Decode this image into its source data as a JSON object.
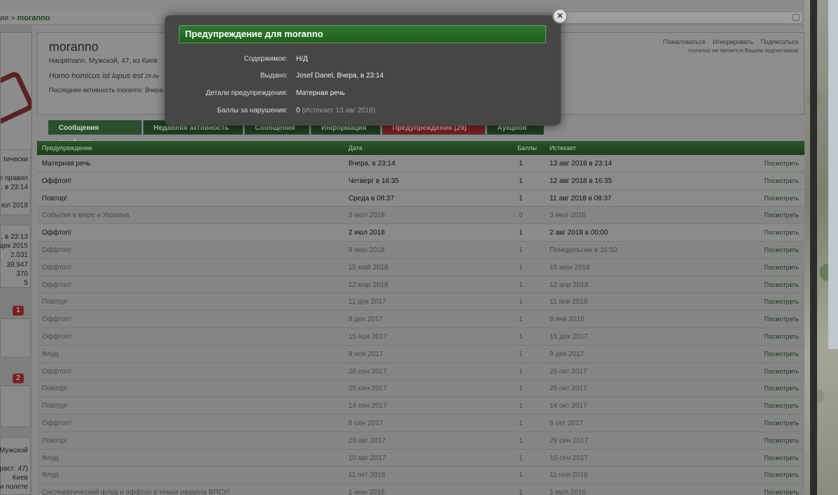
{
  "breadcrumb": {
    "prefix": "ии",
    "separator": "»",
    "current": "moranno"
  },
  "profile": {
    "name": "moranno",
    "info": "Hauptmann, Мужской, 47, из Киев",
    "quote": "Homo homicus ist lupus est",
    "quote_date": "29 де",
    "last_activity": "Последняя активность moranno: Вчера",
    "actions": [
      "Пожаловаться",
      "Игнорировать",
      "Подписаться"
    ],
    "subscription_note": "moranno не является Вашим подписчиком"
  },
  "tabs": [
    {
      "label": "Сообщения профиля"
    },
    {
      "label": "Недавняя активность"
    },
    {
      "label": "Сообщения"
    },
    {
      "label": "Информация"
    },
    {
      "label": "Предупреждения (29)"
    },
    {
      "label": "Аукцион"
    }
  ],
  "sidebar": {
    "texts": [
      "тически",
      "е правил",
      ", в 23:14",
      "юл 2018",
      ", в 23:13",
      "дек 2015",
      "2.031",
      "39.947",
      "370",
      "5",
      "Мужской",
      "раст: 47)",
      "Киев",
      "и полете"
    ],
    "badges": [
      "1",
      "2"
    ]
  },
  "table": {
    "headers": {
      "warning": "Предупреждение",
      "date": "Дата",
      "points": "Баллы",
      "expires": "Истекает"
    },
    "view_label": "Посмотреть",
    "rows": [
      {
        "warning": "Матерная речь",
        "date": "Вчера, в 23:14",
        "points": "1",
        "expires": "13 авг 2018 в 23:14",
        "active": true
      },
      {
        "warning": "Оффтоп!",
        "date": "Четверг в 16:35",
        "points": "1",
        "expires": "12 авг 2018 в 16:35",
        "active": true
      },
      {
        "warning": "Повтор!",
        "date": "Среда в 08:37",
        "points": "1",
        "expires": "11 авг 2018 в 08:37",
        "active": true
      },
      {
        "warning": "События в мире и Украина",
        "date": "3 июл 2018",
        "points": "0",
        "expires": "3 июл 2018",
        "active": false
      },
      {
        "warning": "Оффтоп!",
        "date": "2 июл 2018",
        "points": "1",
        "expires": "2 авг 2018 в 00:00",
        "active": true
      },
      {
        "warning": "Оффтоп!",
        "date": "9 июн 2018",
        "points": "1",
        "expires": "Понедельник в 16:50",
        "active": false
      },
      {
        "warning": "Оффтоп!",
        "date": "15 май 2018",
        "points": "1",
        "expires": "15 июн 2018",
        "active": false
      },
      {
        "warning": "Оффтоп!",
        "date": "12 мар 2018",
        "points": "1",
        "expires": "12 апр 2018",
        "active": false
      },
      {
        "warning": "Повтор!",
        "date": "11 дек 2017",
        "points": "1",
        "expires": "11 янв 2018",
        "active": false
      },
      {
        "warning": "Оффтоп!",
        "date": "8 дек 2017",
        "points": "1",
        "expires": "8 янв 2018",
        "active": false
      },
      {
        "warning": "Оффтоп!",
        "date": "15 ноя 2017",
        "points": "1",
        "expires": "15 дек 2017",
        "active": false
      },
      {
        "warning": "Флуд",
        "date": "9 ноя 2017",
        "points": "1",
        "expires": "9 дек 2017",
        "active": false
      },
      {
        "warning": "Оффтоп!",
        "date": "26 сен 2017",
        "points": "1",
        "expires": "26 окт 2017",
        "active": false
      },
      {
        "warning": "Повтор!",
        "date": "25 сен 2017",
        "points": "1",
        "expires": "25 окт 2017",
        "active": false
      },
      {
        "warning": "Повтор!",
        "date": "14 сен 2017",
        "points": "1",
        "expires": "14 окт 2017",
        "active": false
      },
      {
        "warning": "Оффтоп!",
        "date": "6 сен 2017",
        "points": "1",
        "expires": "6 окт 2017",
        "active": false
      },
      {
        "warning": "Повтор!",
        "date": "29 авг 2017",
        "points": "1",
        "expires": "29 сен 2017",
        "active": false
      },
      {
        "warning": "Флуд",
        "date": "10 авг 2017",
        "points": "1",
        "expires": "10 сен 2017",
        "active": false
      },
      {
        "warning": "Флуд",
        "date": "11 окт 2016",
        "points": "1",
        "expires": "11 ноя 2016",
        "active": false
      },
      {
        "warning": "Систематический флуд и оффтоп в темах раздела ВПСУ!",
        "date": "1 июн 2016",
        "points": "1",
        "expires": "1 июл 2016",
        "active": false
      }
    ]
  },
  "modal": {
    "title": "Предупреждение для moranno",
    "close_glyph": "×",
    "fields": [
      {
        "label": "Содержимое:",
        "value": "Н/Д",
        "extra": ""
      },
      {
        "label": "Выдано:",
        "value": "Josef Danel, Вчера, в 23:14",
        "extra": ""
      },
      {
        "label": "Детали предупреждения:",
        "value": "Матерная речь",
        "extra": ""
      },
      {
        "label": "Баллы за нарушения:",
        "value": "0",
        "extra": "(Истекает 13 авг 2018)"
      }
    ]
  },
  "colors": {
    "accent_green": "#2f7a2f",
    "warn_red": "#7a1e1e"
  }
}
